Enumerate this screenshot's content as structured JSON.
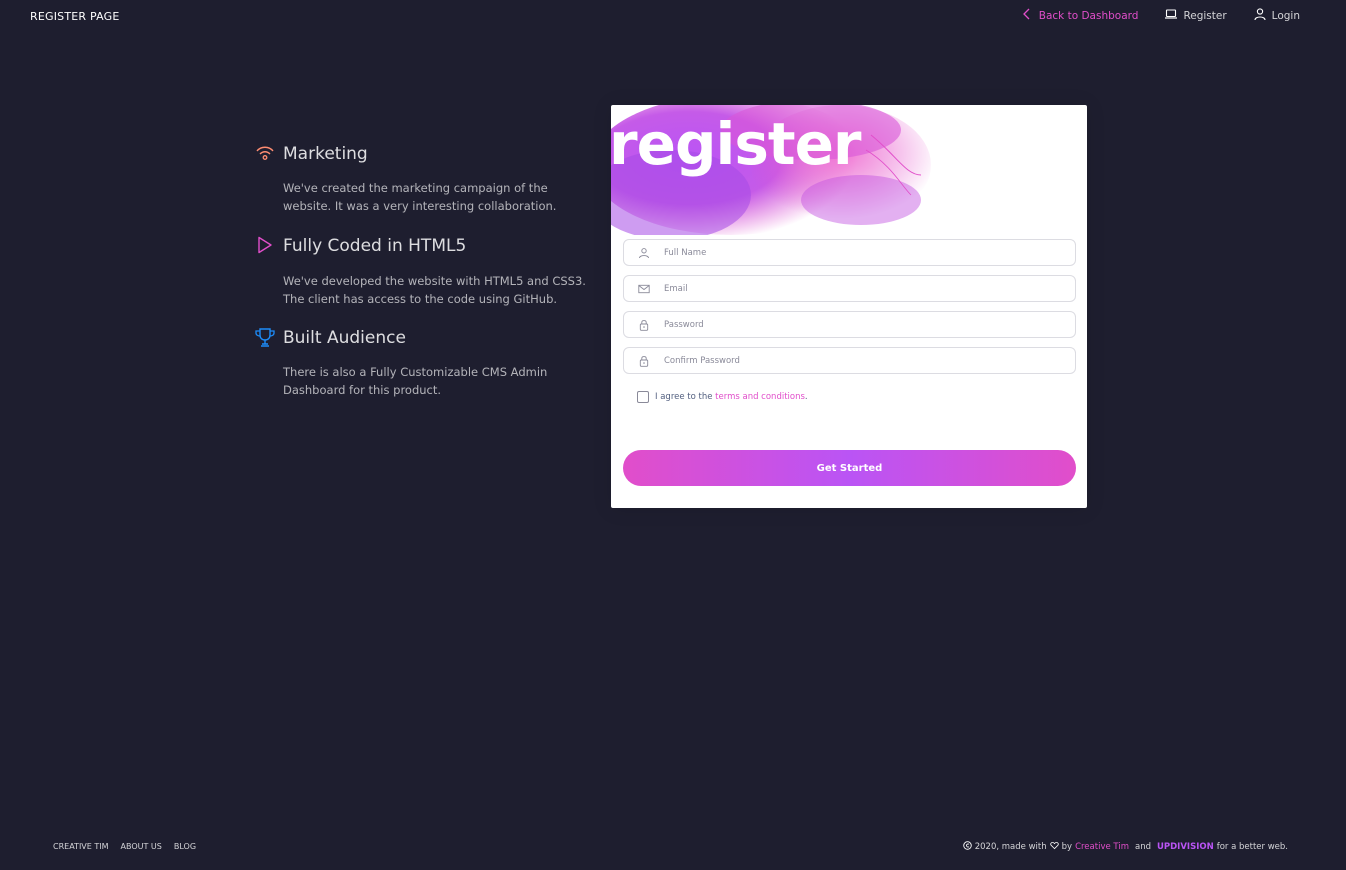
{
  "navbar": {
    "brand": "REGISTER PAGE",
    "back_label": "Back to Dashboard",
    "register_label": "Register",
    "login_label": "Login"
  },
  "info": [
    {
      "title": "Marketing",
      "desc": "We've created the marketing campaign of the website. It was a very interesting collaboration.",
      "icon": "wifi-icon",
      "color": "#ff8d72"
    },
    {
      "title": "Fully Coded in HTML5",
      "desc": "We've developed the website with HTML5 and CSS3. The client has access to the code using GitHub.",
      "icon": "play-icon",
      "color": "#e14eca"
    },
    {
      "title": "Built Audience",
      "desc": "There is also a Fully Customizable CMS Admin Dashboard for this product.",
      "icon": "trophy-icon",
      "color": "#1d8cf8"
    }
  ],
  "card": {
    "title": "register",
    "fields": {
      "full_name": "Full Name",
      "email": "Email",
      "password": "Password",
      "confirm_password": "Confirm Password"
    },
    "agree_prefix": "I agree to the",
    "terms_link": "terms and conditions",
    "agree_suffix": ".",
    "submit_label": "Get Started"
  },
  "footer": {
    "links": [
      "CREATIVE TIM",
      "ABOUT US",
      "BLOG"
    ],
    "copyright_year": "2020, made with",
    "by": "by",
    "author": "Creative Tim",
    "and": "and",
    "partner": "UPDIVISION",
    "suffix": "for a better web."
  },
  "colors": {
    "background": "#1e1e2f",
    "primary": "#e14eca",
    "secondary": "#ba54f5",
    "warning": "#ff8d72",
    "info": "#1d8cf8"
  }
}
